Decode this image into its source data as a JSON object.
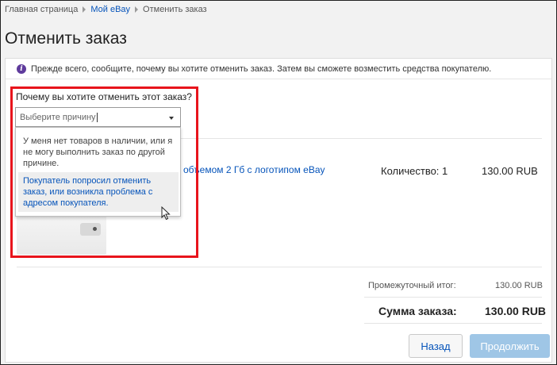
{
  "breadcrumb": {
    "home": "Главная страница",
    "my_ebay": "Мой eBay",
    "current": "Отменить заказ"
  },
  "page_title": "Отменить заказ",
  "info_message": "Прежде всего, сообщите, почему вы хотите отменить заказ. Затем вы сможете возместить средства покупателю.",
  "reason": {
    "label": "Почему вы хотите отменить этот заказ?",
    "placeholder": "Выберите причину",
    "options": [
      "У меня нет товаров в наличии, или я не могу выполнить заказ по другой причине.",
      "Покупатель попросил отменить заказ, или возникла проблема с адресом покупателя."
    ]
  },
  "item": {
    "title_visible": "объемом 2 Гб с логотипом eBay",
    "quantity": "Количество: 1",
    "price": "130.00 RUB"
  },
  "summary": {
    "subtotal_label": "Промежуточный итог:",
    "subtotal_value": "130.00 RUB",
    "total_label": "Сумма заказа:",
    "total_value": "130.00 RUB"
  },
  "buttons": {
    "back": "Назад",
    "continue": "Продолжить"
  },
  "colors": {
    "link": "#0654ba",
    "highlight": "#e8141c",
    "continue_disabled": "#9fc6e6",
    "info_icon": "#5f3b9c"
  }
}
